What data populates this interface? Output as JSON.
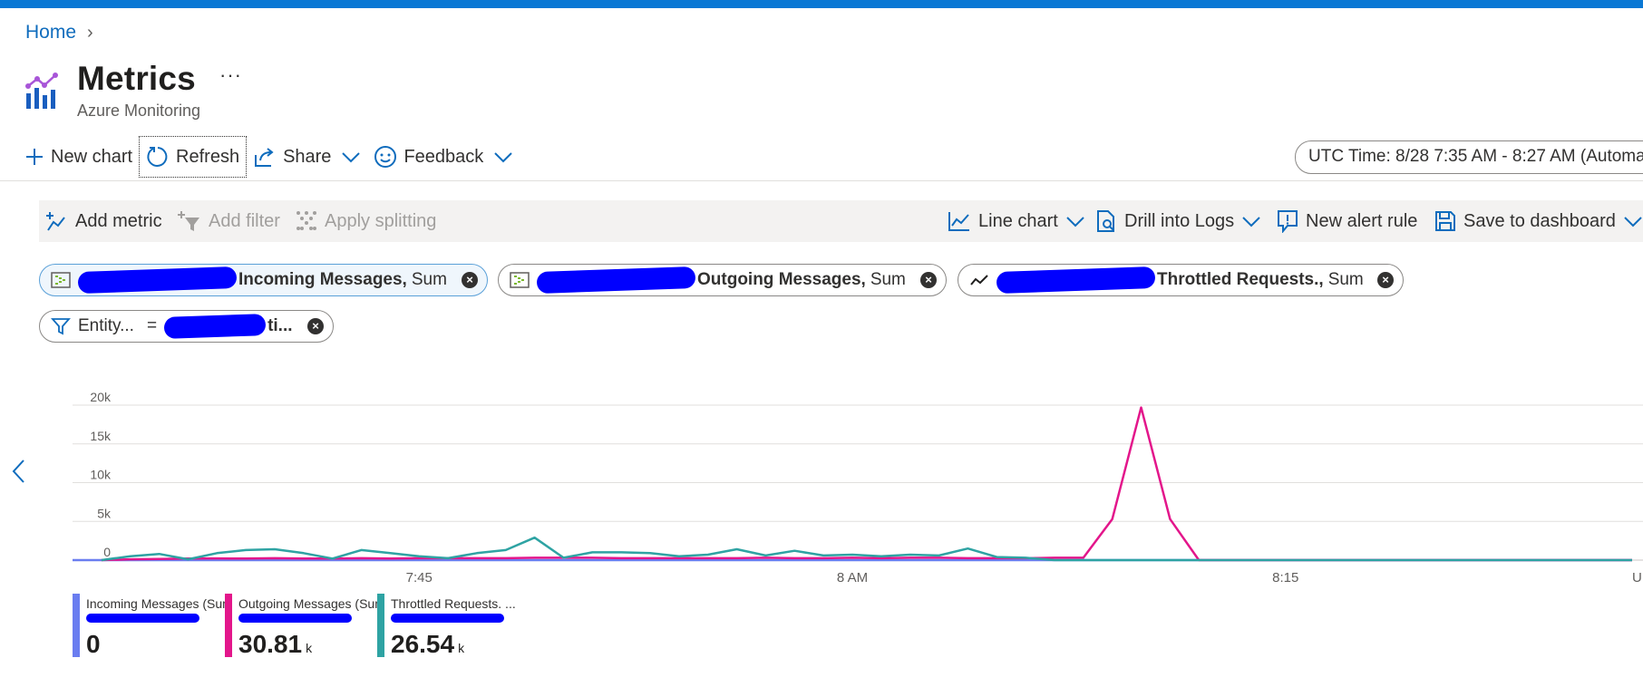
{
  "breadcrumb": {
    "home": "Home"
  },
  "header": {
    "title": "Metrics",
    "subtitle": "Azure Monitoring",
    "more": "···"
  },
  "commands": {
    "new_chart": "New chart",
    "refresh": "Refresh",
    "share": "Share",
    "feedback": "Feedback",
    "time_range": "UTC Time: 8/28 7:35 AM - 8:27 AM (Automa"
  },
  "chart_toolbar": {
    "add_metric": "Add metric",
    "add_filter": "Add filter",
    "apply_splitting": "Apply splitting",
    "line_chart": "Line chart",
    "drill_into_logs": "Drill into Logs",
    "new_alert_rule": "New alert rule",
    "save_to_dashboard": "Save to dashboard"
  },
  "metric_pills": [
    {
      "prefix": "",
      "name": "Incoming Messages,",
      "aggregation": "Sum"
    },
    {
      "prefix": "",
      "name": "Outgoing Messages,",
      "aggregation": "Sum"
    },
    {
      "prefix": "",
      "name": "Throttled Requests.,",
      "aggregation": "Sum"
    }
  ],
  "filter_pill": {
    "label": "Entity...",
    "operator": "=",
    "value_suffix": "ti..."
  },
  "colors": {
    "incoming": "#6a7df0",
    "outgoing": "#e3168b",
    "throttled": "#2ea3a3",
    "accent": "#0a78d4"
  },
  "chart_data": {
    "type": "line",
    "y_ticks": [
      "20k",
      "15k",
      "10k",
      "5k",
      "0"
    ],
    "ylim": [
      0,
      20000
    ],
    "x_ticks": [
      "7:45",
      "8 AM",
      "8:15",
      "U"
    ],
    "x_tick_minutes": [
      45,
      60,
      75,
      87
    ],
    "xlim_minutes": [
      33,
      87
    ],
    "series": [
      {
        "name": "Incoming Messages (Sum)",
        "color": "#6a7df0",
        "x_minutes": [
          33,
          87
        ],
        "values": [
          0,
          0
        ]
      },
      {
        "name": "Outgoing Messages (Sum)",
        "color": "#e3168b",
        "x_minutes": [
          34,
          35,
          36,
          37,
          38,
          39,
          40,
          41,
          42,
          43,
          44,
          45,
          46,
          47,
          48,
          49,
          50,
          51,
          52,
          53,
          54,
          55,
          56,
          57,
          58,
          59,
          60,
          61,
          62,
          63,
          64,
          65,
          66,
          67,
          68,
          69,
          70,
          71,
          72,
          87
        ],
        "values": [
          0,
          100,
          150,
          200,
          220,
          200,
          250,
          200,
          200,
          250,
          200,
          250,
          250,
          250,
          250,
          300,
          300,
          300,
          250,
          250,
          250,
          250,
          250,
          300,
          250,
          250,
          300,
          250,
          300,
          300,
          250,
          250,
          250,
          300,
          300,
          5300,
          19700,
          5300,
          0,
          0
        ]
      },
      {
        "name": "Throttled Requests. ...",
        "color": "#2ea3a3",
        "x_minutes": [
          34,
          35,
          36,
          37,
          38,
          39,
          40,
          41,
          42,
          43,
          44,
          45,
          46,
          47,
          48,
          49,
          50,
          51,
          52,
          53,
          54,
          55,
          56,
          57,
          58,
          59,
          60,
          61,
          62,
          63,
          64,
          65,
          66,
          67,
          68,
          69,
          70,
          71,
          72,
          87
        ],
        "values": [
          0,
          500,
          800,
          100,
          900,
          1300,
          1400,
          900,
          200,
          1300,
          900,
          500,
          250,
          900,
          1300,
          2900,
          300,
          1000,
          1000,
          900,
          500,
          700,
          1400,
          600,
          1200,
          600,
          700,
          500,
          700,
          600,
          1500,
          400,
          300,
          0,
          0,
          0,
          0,
          0,
          0,
          0
        ]
      }
    ]
  },
  "legend": [
    {
      "name": "Incoming Messages (Sum",
      "value": "0",
      "unit": "",
      "color": "#6a7df0"
    },
    {
      "name": "Outgoing Messages (Sum",
      "value": "30.81",
      "unit": "k",
      "color": "#e3168b"
    },
    {
      "name": "Throttled Requests. ...",
      "value": "26.54",
      "unit": "k",
      "color": "#2ea3a3"
    }
  ]
}
